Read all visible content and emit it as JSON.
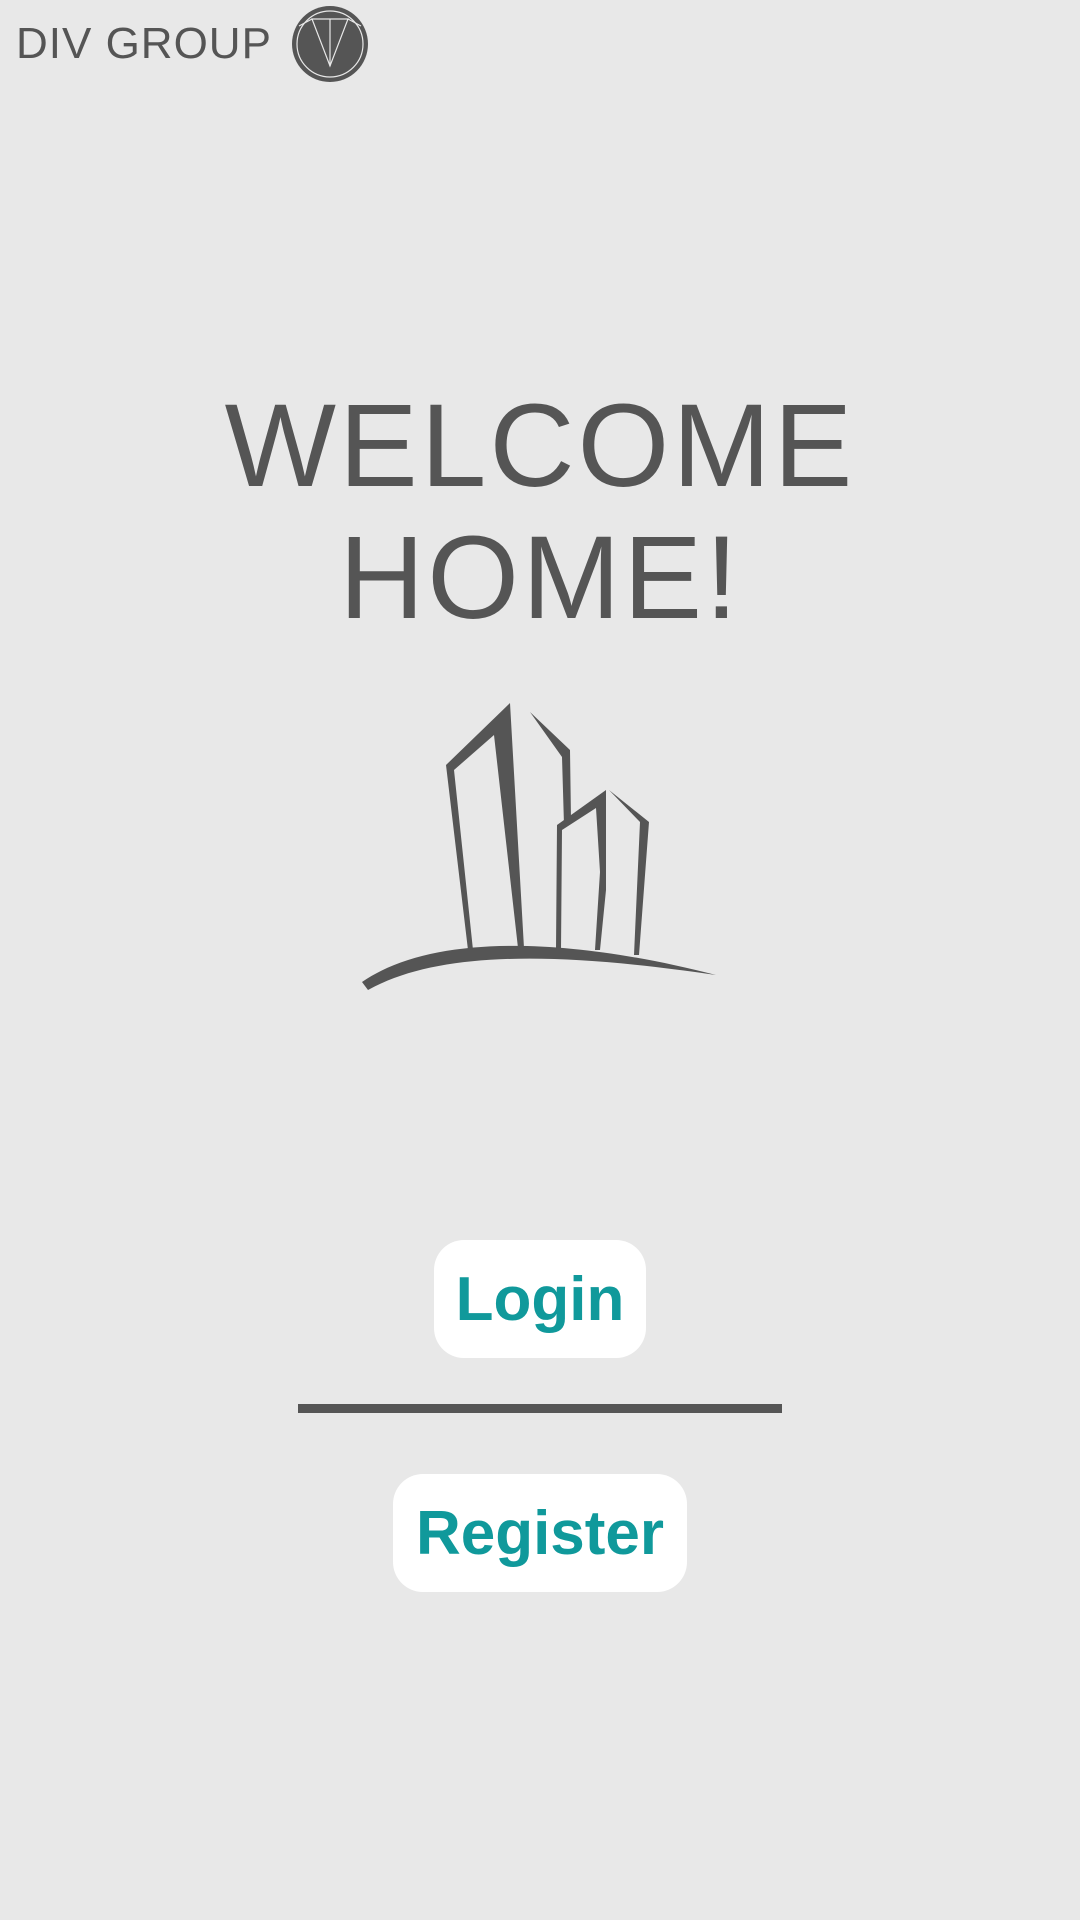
{
  "header": {
    "brand_name": "DIV GROUP",
    "logo_icon": "div-group-logo-icon"
  },
  "welcome": {
    "line1": "WELCOME",
    "line2": "HOME!"
  },
  "illustration": {
    "icon": "city-skyline-icon"
  },
  "actions": {
    "login_label": "Login",
    "register_label": "Register"
  },
  "colors": {
    "background": "#e8e8e8",
    "text": "#555555",
    "accent": "#10999b",
    "button_bg": "#ffffff"
  }
}
